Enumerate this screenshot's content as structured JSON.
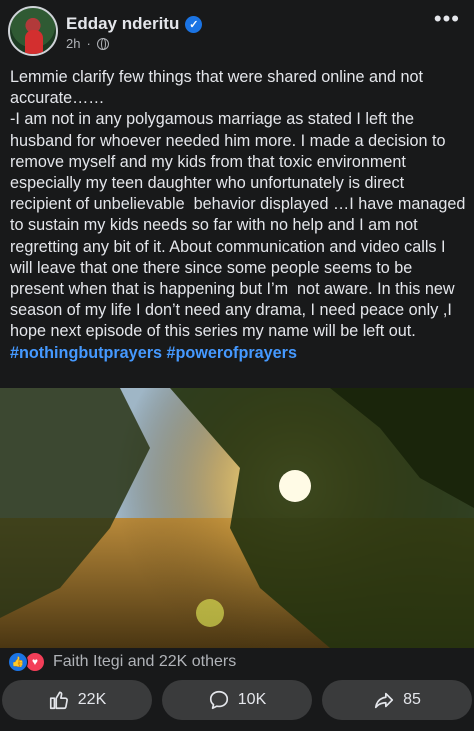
{
  "post": {
    "author": "Edday nderitu",
    "time": "2h",
    "dot": "·",
    "text": "Lemmie clarify few things that were shared online and not accurate……\n-I am not in any polygamous marriage as stated I left the husband for whoever needed him more. I made a decision to remove myself and my kids from that toxic environment especially my teen daughter who unfortunately is direct recipient of unbelievable  behavior displayed …I have managed to sustain my kids needs so far with no help and I am not regretting any bit of it. About communication and video calls I will leave that one there since some people seems to be present when that is happening but I’m  not aware. In this new season of my life I don’t need any drama, I need peace only ,I hope next episode of this series my name will be left out.",
    "hashtags": "#nothingbutprayers #powerofprayers"
  },
  "reactions": {
    "summary": "Faith Itegi and 22K others"
  },
  "actions": {
    "like_count": "22K",
    "comment_count": "10K",
    "share_count": "85"
  },
  "colors": {
    "background": "#18191a",
    "accent": "#1b74e4",
    "hashtag": "#4599ff"
  },
  "icons": [
    "verified-badge-icon",
    "globe-icon",
    "more-options-icon",
    "like-reaction-icon",
    "love-reaction-icon",
    "thumbs-up-icon",
    "comment-icon",
    "share-icon"
  ]
}
